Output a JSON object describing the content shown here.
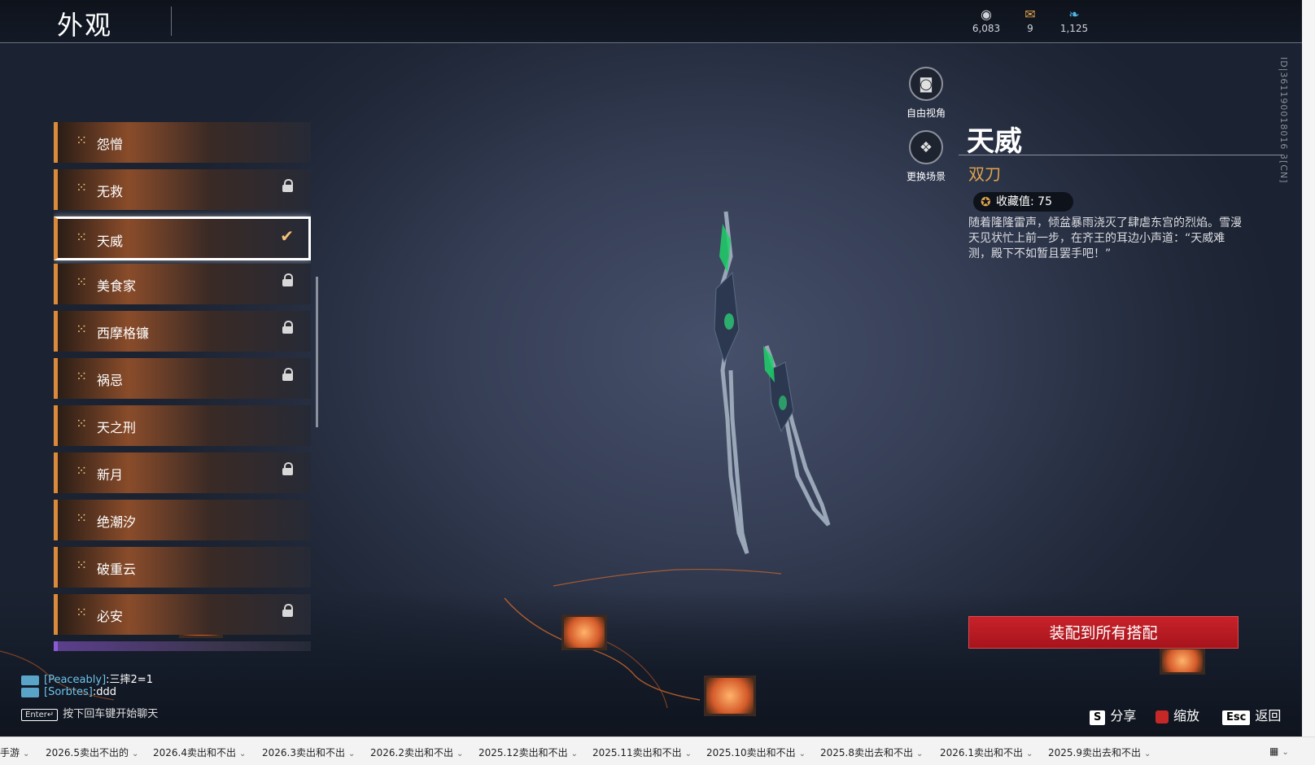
{
  "header": {
    "title": "外观",
    "currencies": [
      {
        "icon": "coin-icon",
        "glyph": "◉",
        "value": "6,083"
      },
      {
        "icon": "ticket-icon",
        "glyph": "✉",
        "value": "9"
      },
      {
        "icon": "feather-icon",
        "glyph": "❧",
        "value": "1,125"
      }
    ]
  },
  "list": {
    "items": [
      {
        "label": "怨憎",
        "locked": false,
        "selected": false
      },
      {
        "label": "无救",
        "locked": true,
        "selected": false
      },
      {
        "label": "天威",
        "locked": false,
        "selected": true
      },
      {
        "label": "美食家",
        "locked": true,
        "selected": false
      },
      {
        "label": "西摩格镰",
        "locked": true,
        "selected": false
      },
      {
        "label": "祸忌",
        "locked": true,
        "selected": false
      },
      {
        "label": "天之刑",
        "locked": false,
        "selected": false
      },
      {
        "label": "新月",
        "locked": true,
        "selected": false
      },
      {
        "label": "绝潮汐",
        "locked": false,
        "selected": false
      },
      {
        "label": "破重云",
        "locked": false,
        "selected": false
      },
      {
        "label": "必安",
        "locked": true,
        "selected": false
      }
    ],
    "item_glyph": "⁙",
    "check_glyph": "✔"
  },
  "tools": {
    "free_camera": "自由视角",
    "change_scene": "更换场景"
  },
  "detail": {
    "name": "天威",
    "type": "双刀",
    "collection_label": "收藏值: 75",
    "description": "随着隆隆雷声，倾盆暴雨浇灭了肆虐东宫的烈焰。雪漫天见状忙上前一步，在齐王的耳边小声道：“天威难测，殿下不如暂且罢手吧！”",
    "id_text": "ID|361190018016 3[CN]",
    "equip_button": "装配到所有搭配"
  },
  "chat": {
    "lines": [
      {
        "name": "[Peaceably]",
        "text": ":三摔2=1"
      },
      {
        "name": "[Sorbtes]",
        "text": ":ddd"
      }
    ],
    "enter_key": "Enter↵",
    "hint": "按下回车键开始聊天"
  },
  "hints": {
    "share_key": "S",
    "share": "分享",
    "zoom": "缩放",
    "back_key": "Esc",
    "back": "返回"
  },
  "taskbar": {
    "tabs": [
      "手游",
      "2026.5卖出不出的",
      "2026.4卖出和不出",
      "2026.3卖出和不出",
      "2026.2卖出和不出",
      "2025.12卖出和不出",
      "2025.11卖出和不出",
      "2025.10卖出和不出",
      "2025.8卖出去和不出",
      "2026.1卖出和不出",
      "2025.9卖出去和不出"
    ]
  },
  "colors": {
    "accent_orange": "#d98a3c",
    "gold": "#e0a34e",
    "button_red": "#b81a22",
    "chat_name": "#6dc4ec"
  }
}
